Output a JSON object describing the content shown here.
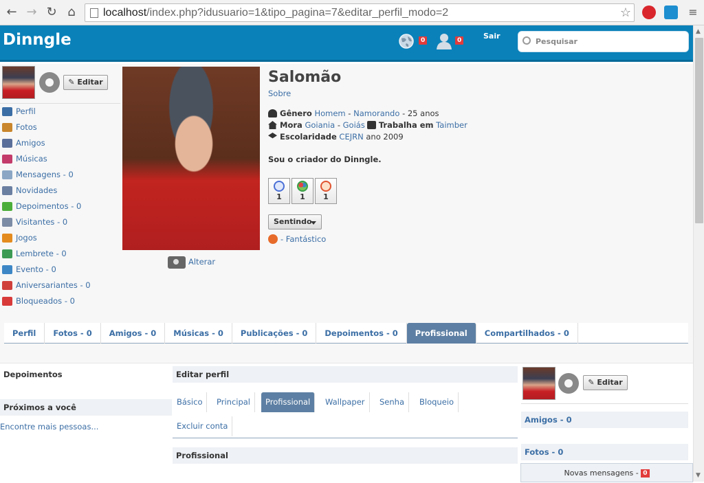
{
  "browser": {
    "url_domain": "localhost",
    "url_path": "/index.php?idusuario=1&tipo_pagina=7&editar_perfil_modo=2"
  },
  "header": {
    "logo": "Dinngle",
    "world_badge": "0",
    "user_badge": "0",
    "logout": "Sair",
    "search_placeholder": "Pesquisar"
  },
  "profile": {
    "edit_label": "Editar",
    "name": "Salomão",
    "about_link": "Sobre",
    "gender_label": "Gênero",
    "gender": "Homem",
    "relationship": "Namorando",
    "age": "- 25 anos",
    "lives_label": "Mora",
    "city": "Goiania",
    "state": "Goiás",
    "works_label": "Trabalha em",
    "company": "Taimber",
    "education_label": "Escolaridade",
    "school": "CEJRN",
    "school_year": "ano 2009",
    "bio": "Sou o criador do Dinngle.",
    "moods": [
      {
        "count": "1",
        "color": "#4a6fd6"
      },
      {
        "count": "1",
        "color": "#3aa04a"
      },
      {
        "count": "1",
        "color": "#e0532f"
      }
    ],
    "feeling_button": "Sentindo",
    "feeling_text": "- Fantástico",
    "change_photo": "Alterar"
  },
  "left_nav": [
    {
      "label": "Perfil",
      "icon": "user-icon",
      "color": "#3b6ea5"
    },
    {
      "label": "Fotos",
      "icon": "photos-icon",
      "color": "#c9862c"
    },
    {
      "label": "Amigos",
      "icon": "friends-icon",
      "color": "#5a6f9a"
    },
    {
      "label": "Músicas",
      "icon": "music-icon",
      "color": "#c33b6a"
    },
    {
      "label": "Mensagens - 0",
      "icon": "mail-icon",
      "color": "#8aa6c4"
    },
    {
      "label": "Novidades",
      "icon": "rss-icon",
      "color": "#6b7fa1"
    },
    {
      "label": "Depoimentos - 0",
      "icon": "comment-icon",
      "color": "#4cae3a"
    },
    {
      "label": "Visitantes - 0",
      "icon": "home-icon",
      "color": "#7c8ca5"
    },
    {
      "label": "Jogos",
      "icon": "game-icon",
      "color": "#e48b1f"
    },
    {
      "label": "Lembrete - 0",
      "icon": "clock-icon",
      "color": "#3c9a54"
    },
    {
      "label": "Evento - 0",
      "icon": "calendar-icon",
      "color": "#3d86c6"
    },
    {
      "label": "Aniversariantes - 0",
      "icon": "gift-icon",
      "color": "#d0403b"
    },
    {
      "label": "Bloqueados - 0",
      "icon": "block-icon",
      "color": "#d83a3a"
    }
  ],
  "tabs": [
    {
      "label": "Perfil",
      "active": false
    },
    {
      "label": "Fotos - 0",
      "active": false
    },
    {
      "label": "Amigos - 0",
      "active": false
    },
    {
      "label": "Músicas - 0",
      "active": false
    },
    {
      "label": "Publicações - 0",
      "active": false
    },
    {
      "label": "Depoimentos - 0",
      "active": false
    },
    {
      "label": "Profissional",
      "active": true
    },
    {
      "label": "Compartilhados - 0",
      "active": false
    }
  ],
  "lower": {
    "depoimentos": "Depoimentos",
    "proximos": "Próximos a você",
    "encontre": "Encontre mais pessoas...",
    "editar_perfil": "Editar perfil",
    "sub_tabs": [
      "Básico",
      "Principal",
      "Profissional",
      "Wallpaper",
      "Senha",
      "Bloqueio",
      "Excluir conta"
    ],
    "active_sub_tab": "Profissional",
    "section_title": "Profissional",
    "right_edit": "Editar",
    "right_amigos": "Amigos - 0",
    "right_fotos": "Fotos - 0",
    "messages": "Novas mensagens -",
    "messages_count": "0"
  }
}
